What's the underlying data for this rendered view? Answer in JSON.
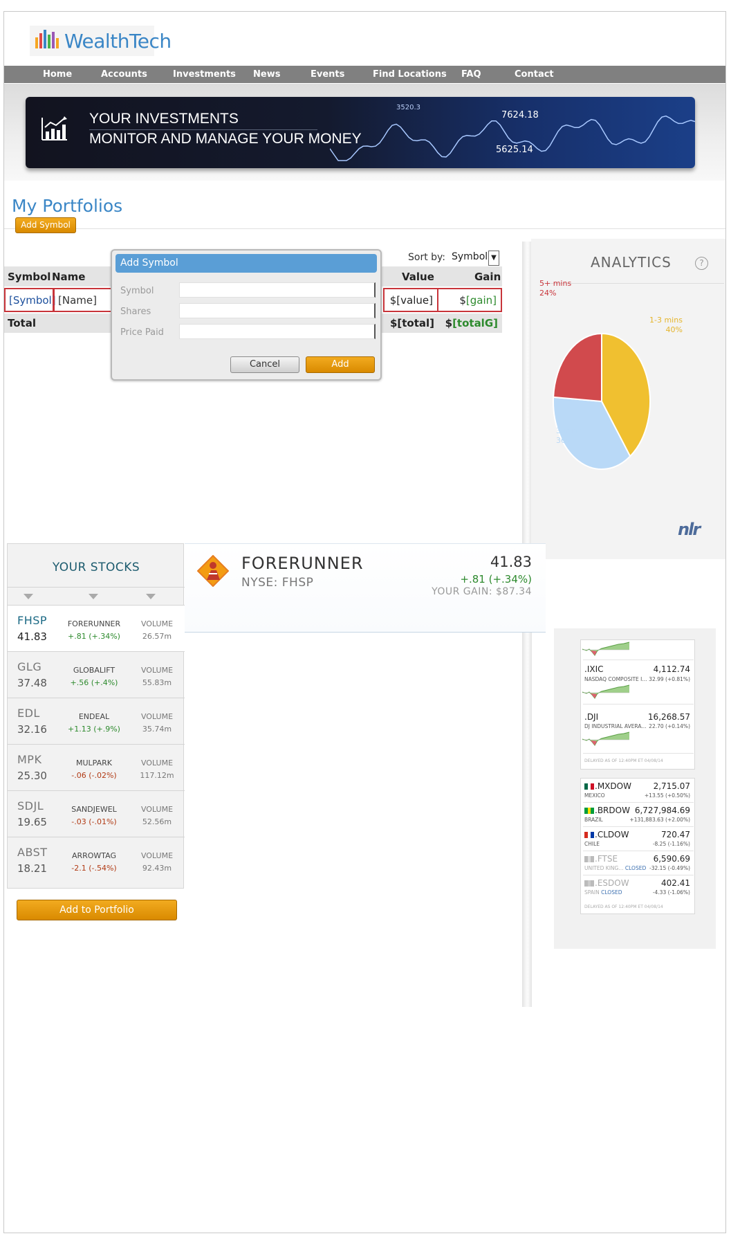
{
  "brand": {
    "name": "WealthTech"
  },
  "nav": {
    "items": [
      "Home",
      "Accounts",
      "Investments",
      "News",
      "Events",
      "Find Locations",
      "FAQ",
      "Contact"
    ]
  },
  "banner": {
    "line1": "YOUR INVESTMENTS",
    "line2": "MONITOR AND MANAGE YOUR MONEY",
    "chart_numbers": [
      "3520.3",
      "7624.18",
      "5625.14"
    ]
  },
  "page": {
    "title": "My Portfolios"
  },
  "toolbar": {
    "add_symbol_label": "Add Symbol",
    "sort_label": "Sort by:",
    "sort_value": "Symbol"
  },
  "portfolio_table": {
    "headers": {
      "symbol": "Symbol",
      "name": "Name",
      "value": "Value",
      "gain": "Gain"
    },
    "row": {
      "symbol": "[Symbol]",
      "name": "[Name]",
      "value": "$[value]",
      "gain_prefix": "$",
      "gain": "[gain]"
    },
    "total": {
      "label": "Total",
      "value": "$[total]",
      "gain_prefix": "$",
      "gain": "[totalG]"
    }
  },
  "dialog": {
    "title": "Add Symbol",
    "fields": [
      {
        "label": "Symbol",
        "value": ""
      },
      {
        "label": "Shares",
        "value": ""
      },
      {
        "label": "Price Paid",
        "value": ""
      }
    ],
    "cancel_label": "Cancel",
    "add_label": "Add"
  },
  "analytics": {
    "title": "ANALYTICS",
    "help_glyph": "?",
    "chart_data": {
      "type": "pie",
      "slices": [
        {
          "label": "1-3 mins",
          "value": 40,
          "display": "40%",
          "color": "#f0c030"
        },
        {
          "label": "3 mins",
          "value": 36,
          "display": "36%",
          "color": "#b9d9f7"
        },
        {
          "label": "5+ mins",
          "value": 24,
          "display": "24%",
          "color": "#d14a4d"
        }
      ]
    },
    "brand_mark": "nlr"
  },
  "stocks": {
    "title": "YOUR STOCKS",
    "items": [
      {
        "symbol": "FHSP",
        "price": "41.83",
        "name": "FORERUNNER",
        "change": "+.81 (+.34%)",
        "direction": "up",
        "volume_label": "VOLUME",
        "volume": "26.57m",
        "active": true
      },
      {
        "symbol": "GLG",
        "price": "37.48",
        "name": "GLOBALIFT",
        "change": "+.56 (+.4%)",
        "direction": "up",
        "volume_label": "VOLUME",
        "volume": "55.83m",
        "active": false
      },
      {
        "symbol": "EDL",
        "price": "32.16",
        "name": "ENDEAL",
        "change": "+1.13 (+.9%)",
        "direction": "up",
        "volume_label": "VOLUME",
        "volume": "35.74m",
        "active": false
      },
      {
        "symbol": "MPK",
        "price": "25.30",
        "name": "MULPARK",
        "change": "-.06 (-.02%)",
        "direction": "down",
        "volume_label": "VOLUME",
        "volume": "117.12m",
        "active": false
      },
      {
        "symbol": "SDJL",
        "price": "19.65",
        "name": "SANDJEWEL",
        "change": "-.03 (-.01%)",
        "direction": "down",
        "volume_label": "VOLUME",
        "volume": "52.56m",
        "active": false
      },
      {
        "symbol": "ABST",
        "price": "18.21",
        "name": "ARROWTAG",
        "change": "-2.1 (-.54%)",
        "direction": "down",
        "volume_label": "VOLUME",
        "volume": "92.43m",
        "active": false
      }
    ]
  },
  "detail": {
    "name": "FORERUNNER",
    "exchange": "NYSE: FHSP",
    "price": "41.83",
    "change": "+.81 (+.34%)",
    "gain": "YOUR GAIN: $87.34"
  },
  "add_portfolio_label": "Add to Portfolio",
  "markets": {
    "us": [
      {
        "symbol": ".IXIC",
        "value": "4,112.74",
        "sub": "NASDAQ COMPOSITE I...",
        "change": "32.99 (+0.81%)"
      },
      {
        "symbol": ".DJI",
        "value": "16,268.57",
        "sub": "DJ INDUSTRIAL AVERA...",
        "change": "22.70 (+0.14%)"
      }
    ],
    "us_footer": "DELAYED AS OF 12:40PM ET 04/08/14",
    "intl": [
      {
        "symbol": ".MXDOW",
        "value": "2,715.07",
        "sub": "MEXICO",
        "status": "",
        "change": "+13.55 (+0.50%)",
        "closed": false
      },
      {
        "symbol": ".BRDOW",
        "value": "6,727,984.69",
        "sub": "BRAZIL",
        "status": "",
        "change": "+131,883.63 (+2.00%)",
        "closed": false
      },
      {
        "symbol": ".CLDOW",
        "value": "720.47",
        "sub": "CHILE",
        "status": "",
        "change": "-8.25 (-1.16%)",
        "closed": false
      },
      {
        "symbol": ".FTSE",
        "value": "6,590.69",
        "sub": "UNITED KING...",
        "status": "CLOSED",
        "change": "-32.15 (-0.49%)",
        "closed": true
      },
      {
        "symbol": ".ESDOW",
        "value": "402.41",
        "sub": "SPAIN",
        "status": "CLOSED",
        "change": "-4.33 (-1.06%)",
        "closed": true
      }
    ],
    "intl_footer": "DELAYED AS OF 12:40PM ET 04/08/14"
  }
}
